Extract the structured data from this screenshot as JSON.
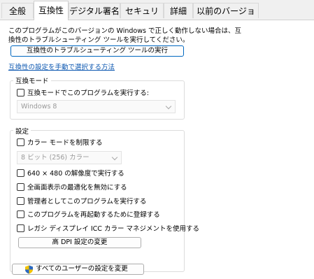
{
  "tabs": [
    {
      "label": "全般"
    },
    {
      "label": "互換性"
    },
    {
      "label": "デジタル署名"
    },
    {
      "label": "セキュリティ"
    },
    {
      "label": "詳細"
    },
    {
      "label": "以前のバージョン"
    }
  ],
  "active_tab": "互換性",
  "description": {
    "line1": "このプログラムがこのバージョンの Windows で正しく動作しない場合は、互",
    "line2": "換性のトラブルシューティング ツールを実行してください。"
  },
  "troubleshooter_button": "互換性のトラブルシューティング ツールの実行",
  "manual_link": "互換性の設定を手動で選択する方法",
  "compat_mode": {
    "title": "互換モード",
    "checkbox_label": "互換モードでこのプログラムを実行する:",
    "checked": false,
    "os_select_value": "Windows 8"
  },
  "settings": {
    "title": "設定",
    "reduced_color": {
      "label": "カラー モードを制限する",
      "checked": false
    },
    "color_select_value": "8 ビット (256) カラー",
    "options": [
      {
        "label": "640 × 480 の解像度で実行する",
        "checked": false
      },
      {
        "label": "全画面表示の最適化を無効にする",
        "checked": false
      },
      {
        "label": "管理者としてこのプログラムを実行する",
        "checked": false
      },
      {
        "label": "このプログラムを再起動するために登録する",
        "checked": false
      },
      {
        "label": "レガシ ディスプレイ ICC カラー マネジメントを使用する",
        "checked": false
      }
    ],
    "dpi_button": "高 DPI 設定の変更"
  },
  "all_users_button": "すべてのユーザーの設定を変更",
  "colors": {
    "accent": "#0067c0",
    "link": "#0a56b0",
    "panel_bg": "#ffffff",
    "window_bg": "#f0f0f0"
  },
  "icons": {
    "all_users_button": "uac-shield-icon"
  }
}
